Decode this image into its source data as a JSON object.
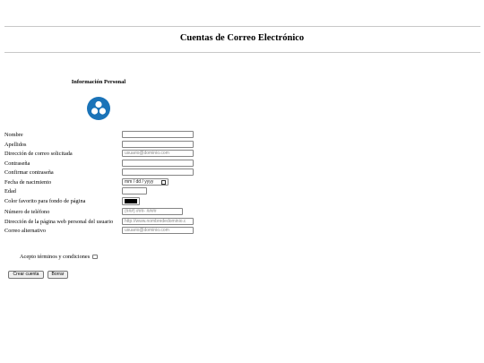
{
  "header": {
    "title": "Cuentas de Correo Electrónico"
  },
  "section": {
    "title": "Información Personal",
    "avatar_icon": "user-group-icon",
    "avatar_color": "#1a73b8"
  },
  "form": {
    "fields": [
      {
        "label": "Nombre",
        "value": "",
        "placeholder": ""
      },
      {
        "label": "Apellidos",
        "value": "",
        "placeholder": ""
      },
      {
        "label": "Dirección de correo solicitada",
        "value": "",
        "placeholder": "usuario@dominio.com"
      },
      {
        "label": "Contraseña",
        "value": "",
        "placeholder": ""
      },
      {
        "label": "Confirmar contraseña",
        "value": "",
        "placeholder": ""
      },
      {
        "label": "Fecha de nacimiento",
        "value": "",
        "placeholder": "mm / dd / yyyy"
      },
      {
        "label": "Edad",
        "value": "",
        "placeholder": ""
      },
      {
        "label": "Color favorito para fondo de página",
        "value": "#000000",
        "placeholder": ""
      },
      {
        "label": "Número de teléfono",
        "value": "",
        "placeholder": "(###) ###- ####"
      },
      {
        "label": "Dirección de la página web personal del usuario",
        "value": "",
        "placeholder": "http://www.nombrededominio.c"
      },
      {
        "label": "Correo alternativo",
        "value": "",
        "placeholder": "usuario@dominio.com"
      }
    ],
    "terms_label": "Acepto términos y condiciones",
    "terms_checked": false,
    "submit_label": "Crear cuenta",
    "reset_label": "Borrar"
  }
}
